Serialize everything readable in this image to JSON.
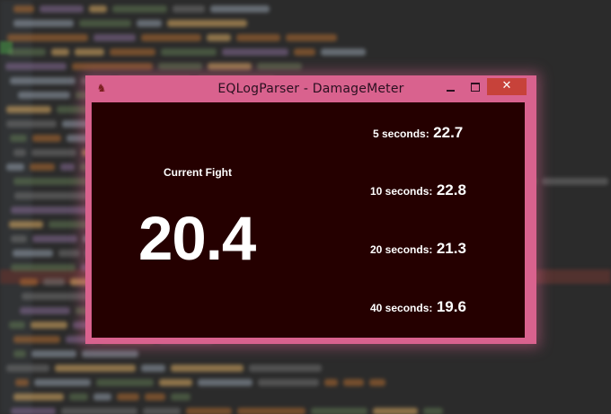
{
  "window": {
    "title": "EQLogParser - DamageMeter",
    "close_glyph": "✕",
    "app_icon_glyph": "♞"
  },
  "meter": {
    "current_label": "Current Fight",
    "current_value": "20.4",
    "stats": [
      {
        "label": "5 seconds:",
        "value": "22.7"
      },
      {
        "label": "10 seconds:",
        "value": "22.8"
      },
      {
        "label": "20 seconds:",
        "value": "21.3"
      },
      {
        "label": "40 seconds:",
        "value": "19.6"
      }
    ]
  },
  "colors": {
    "window_frame": "#d9628e",
    "client_bg": "#250000",
    "close_button": "#c7423a",
    "ide_bg": "#2b2b2b"
  }
}
